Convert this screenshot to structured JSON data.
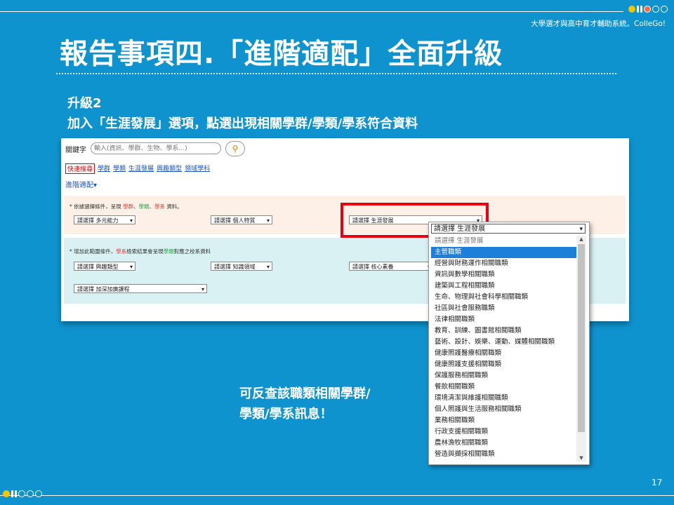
{
  "slide": {
    "subtitle": "大學選才與高中育才輔助系統。ColleGo!",
    "title": "報告事項四.「進階適配」全面升級",
    "upgrade_line1": "升級2",
    "upgrade_line2": "加入「生涯發展」選項，點選出現相關學群/學類/學系符合資料",
    "callout_line1": "可反查該職類相關學群/",
    "callout_line2": "學類/學系訊息！",
    "page_number": "17"
  },
  "screenshot": {
    "keyword_label": "關鍵字",
    "keyword_placeholder": "輸入(資訊、學群、生物、學系...)",
    "tabs": [
      "快速搜尋",
      "學群",
      "學類",
      "生涯發展",
      "興趣類型",
      "領域學科"
    ],
    "advanced_label": "進階適配▾",
    "section1_note_prefix": "* 依據選擇條件，呈現",
    "section1_note_a": "學群",
    "section1_note_b": "學類",
    "section1_note_c": "學系",
    "section1_note_suffix": "資料。",
    "section2_note_prefix": "* 增加此範圍條件，",
    "section2_note_a": "學系",
    "section2_note_mid": "檢索結果會呈現",
    "section2_note_b": "學類",
    "section2_note_suffix": "對應之校系資料",
    "selects": {
      "multi_ability": "請選擇 多元能力",
      "personal_trait": "請選擇 個人特質",
      "career": "請選擇 生涯發展",
      "interest_type": "請選擇 興趣類型",
      "knowledge_field": "請選擇 知識領域",
      "core_literacy": "請選擇 核心素養",
      "advanced_course": "請選擇 加深加廣課程"
    }
  },
  "dropdown": {
    "selected": "請選擇 生涯發展",
    "highlighted_index": 1,
    "options": [
      "請選擇 生涯發展",
      "主管職類",
      "經營與財務運作相關職類",
      "資訊與數學相關職類",
      "建築與工程相關職類",
      "生命、物理與社會科學相關職類",
      "社區與社會服務職類",
      "法律相關職類",
      "教育、訓練、圖書館相關職類",
      "藝術、設計、娛樂、運動、媒體相關職類",
      "健康照護醫療相關職類",
      "健康照護支援相關職類",
      "保護服務相關職類",
      "餐飲相關職類",
      "環境清潔與維護相關職類",
      "個人照護與生活服務相關職類",
      "業務相關職類",
      "行政支援相關職類",
      "農林漁牧相關職類",
      "營造與擷採相關職類"
    ]
  },
  "colors": {
    "background": "#0f93cf",
    "highlight_box": "#e60012",
    "selected_option": "#1e7fd8"
  }
}
